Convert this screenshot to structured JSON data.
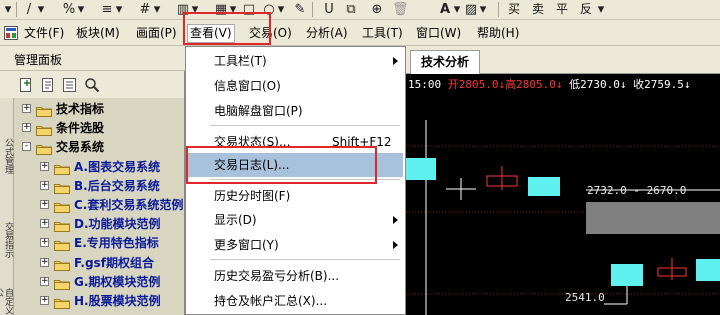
{
  "menubar": {
    "items": [
      "文件(F)",
      "板块(M)",
      "画面(P)",
      "查看(V)",
      "交易(O)",
      "分析(A)",
      "工具(T)",
      "窗口(W)",
      "帮助(H)"
    ]
  },
  "toolbar": {
    "trade_labels": [
      "买",
      "卖",
      "平",
      "反"
    ]
  },
  "left_panel": {
    "title": "管理面板",
    "vertical_tabs": [
      "公式管理",
      "交易指示",
      "自定义公"
    ],
    "tree": [
      {
        "label": "技术指标",
        "level": 0,
        "expand": "+"
      },
      {
        "label": "条件选股",
        "level": 0,
        "expand": "+"
      },
      {
        "label": "交易系统",
        "level": 0,
        "expand": "-"
      },
      {
        "label": "A.图表交易系统",
        "level": 1,
        "expand": "+"
      },
      {
        "label": "B.后台交易系统",
        "level": 1,
        "expand": "+"
      },
      {
        "label": "C.套利交易系统范例",
        "level": 1,
        "expand": "+"
      },
      {
        "label": "D.功能模块范例",
        "level": 1,
        "expand": "+"
      },
      {
        "label": "E.专用特色指标",
        "level": 1,
        "expand": "+"
      },
      {
        "label": "F.gsf期权组合",
        "level": 1,
        "expand": "+"
      },
      {
        "label": "G.期权模块范例",
        "level": 1,
        "expand": "+"
      },
      {
        "label": "H.股票模块范例",
        "level": 1,
        "expand": "+"
      }
    ]
  },
  "dropdown": {
    "items": [
      {
        "label": "工具栏(T)",
        "submenu": true,
        "shortcut": ""
      },
      {
        "label": "信息窗口(O)",
        "submenu": false,
        "shortcut": ""
      },
      {
        "label": "电脑解盘窗口(P)",
        "submenu": false,
        "shortcut": ""
      },
      {
        "label": "交易状态(S)...",
        "submenu": false,
        "shortcut": "Shift+F12"
      },
      {
        "label": "交易日志(L)...",
        "submenu": false,
        "shortcut": "",
        "highlighted": true
      },
      {
        "label": "历史分时图(F)",
        "submenu": false,
        "shortcut": ""
      },
      {
        "label": "显示(D)",
        "submenu": true,
        "shortcut": ""
      },
      {
        "label": "更多窗口(Y)",
        "submenu": true,
        "shortcut": ""
      },
      {
        "label": "历史交易盈亏分析(B)...",
        "submenu": false,
        "shortcut": ""
      },
      {
        "label": "持仓及帐户汇总(X)...",
        "submenu": false,
        "shortcut": ""
      }
    ]
  },
  "chart": {
    "tab_label": "技术分析",
    "time": "15:00",
    "open": "开2805.0↓",
    "high": "高2805.0↓",
    "low": "低2730.0↓",
    "close": "收2759.5↓",
    "range_label": "2732.0 - 2670.0",
    "low_label": "2541.0",
    "colors": {
      "up": "#5ff0f0",
      "down": "#ff3333",
      "info_white": "#ffffff"
    }
  }
}
